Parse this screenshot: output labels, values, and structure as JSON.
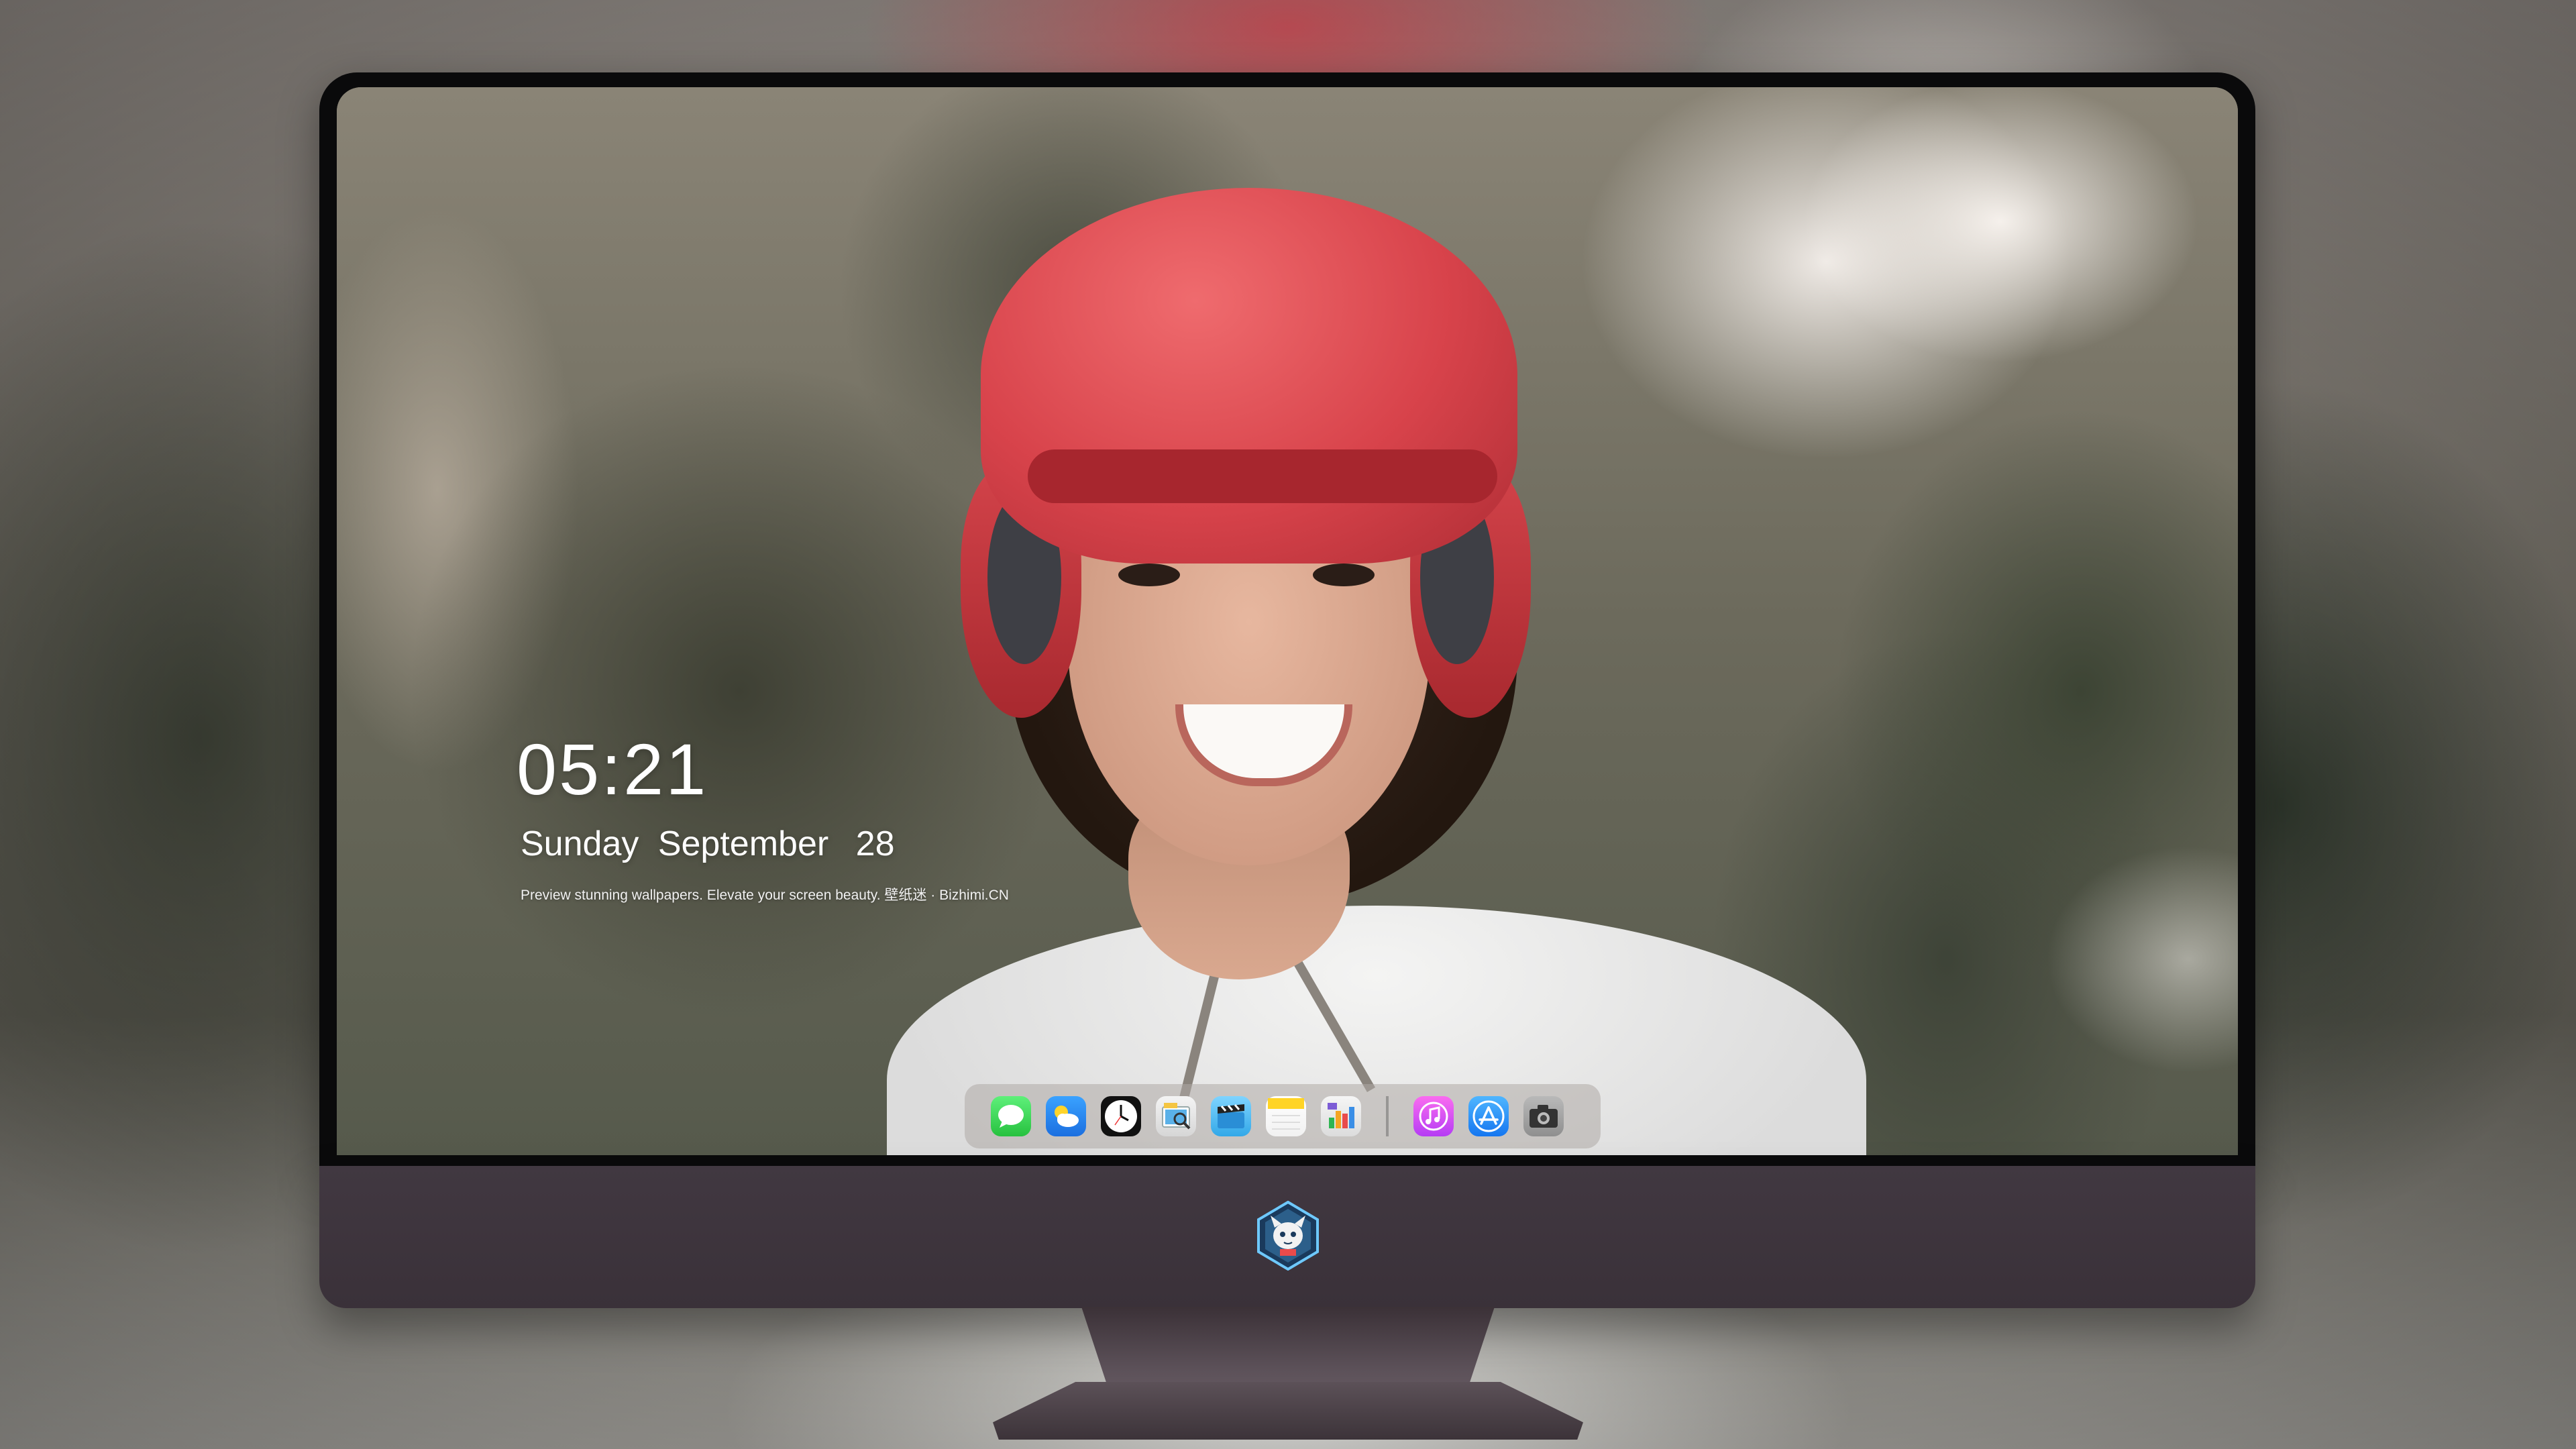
{
  "lockscreen": {
    "time": "05:21",
    "weekday": "Sunday",
    "month": "September",
    "day": "28",
    "tagline": "Preview stunning wallpapers. Elevate your screen beauty. 壁纸迷 · Bizhimi.CN"
  },
  "dock": {
    "apps": [
      {
        "name": "messages-icon",
        "color": "#34c759"
      },
      {
        "name": "weather-icon",
        "color": "#1b84f2"
      },
      {
        "name": "clock-icon",
        "color": "#111111"
      },
      {
        "name": "preview-icon",
        "color": "#e2e2e2"
      },
      {
        "name": "clips-icon",
        "color": "#4bb8f0"
      },
      {
        "name": "notes-icon",
        "color": "#ffd426"
      },
      {
        "name": "numbers-icon",
        "color": "#2fb552"
      },
      {
        "name": "itunes-icon",
        "color": "#e34df0"
      },
      {
        "name": "app-store-icon",
        "color": "#1d8cf8"
      },
      {
        "name": "camera-icon",
        "color": "#a6a6a6"
      }
    ]
  },
  "monitor": {
    "logo": "bizhimi-mascot-logo",
    "chin_color": "#3e353d"
  }
}
